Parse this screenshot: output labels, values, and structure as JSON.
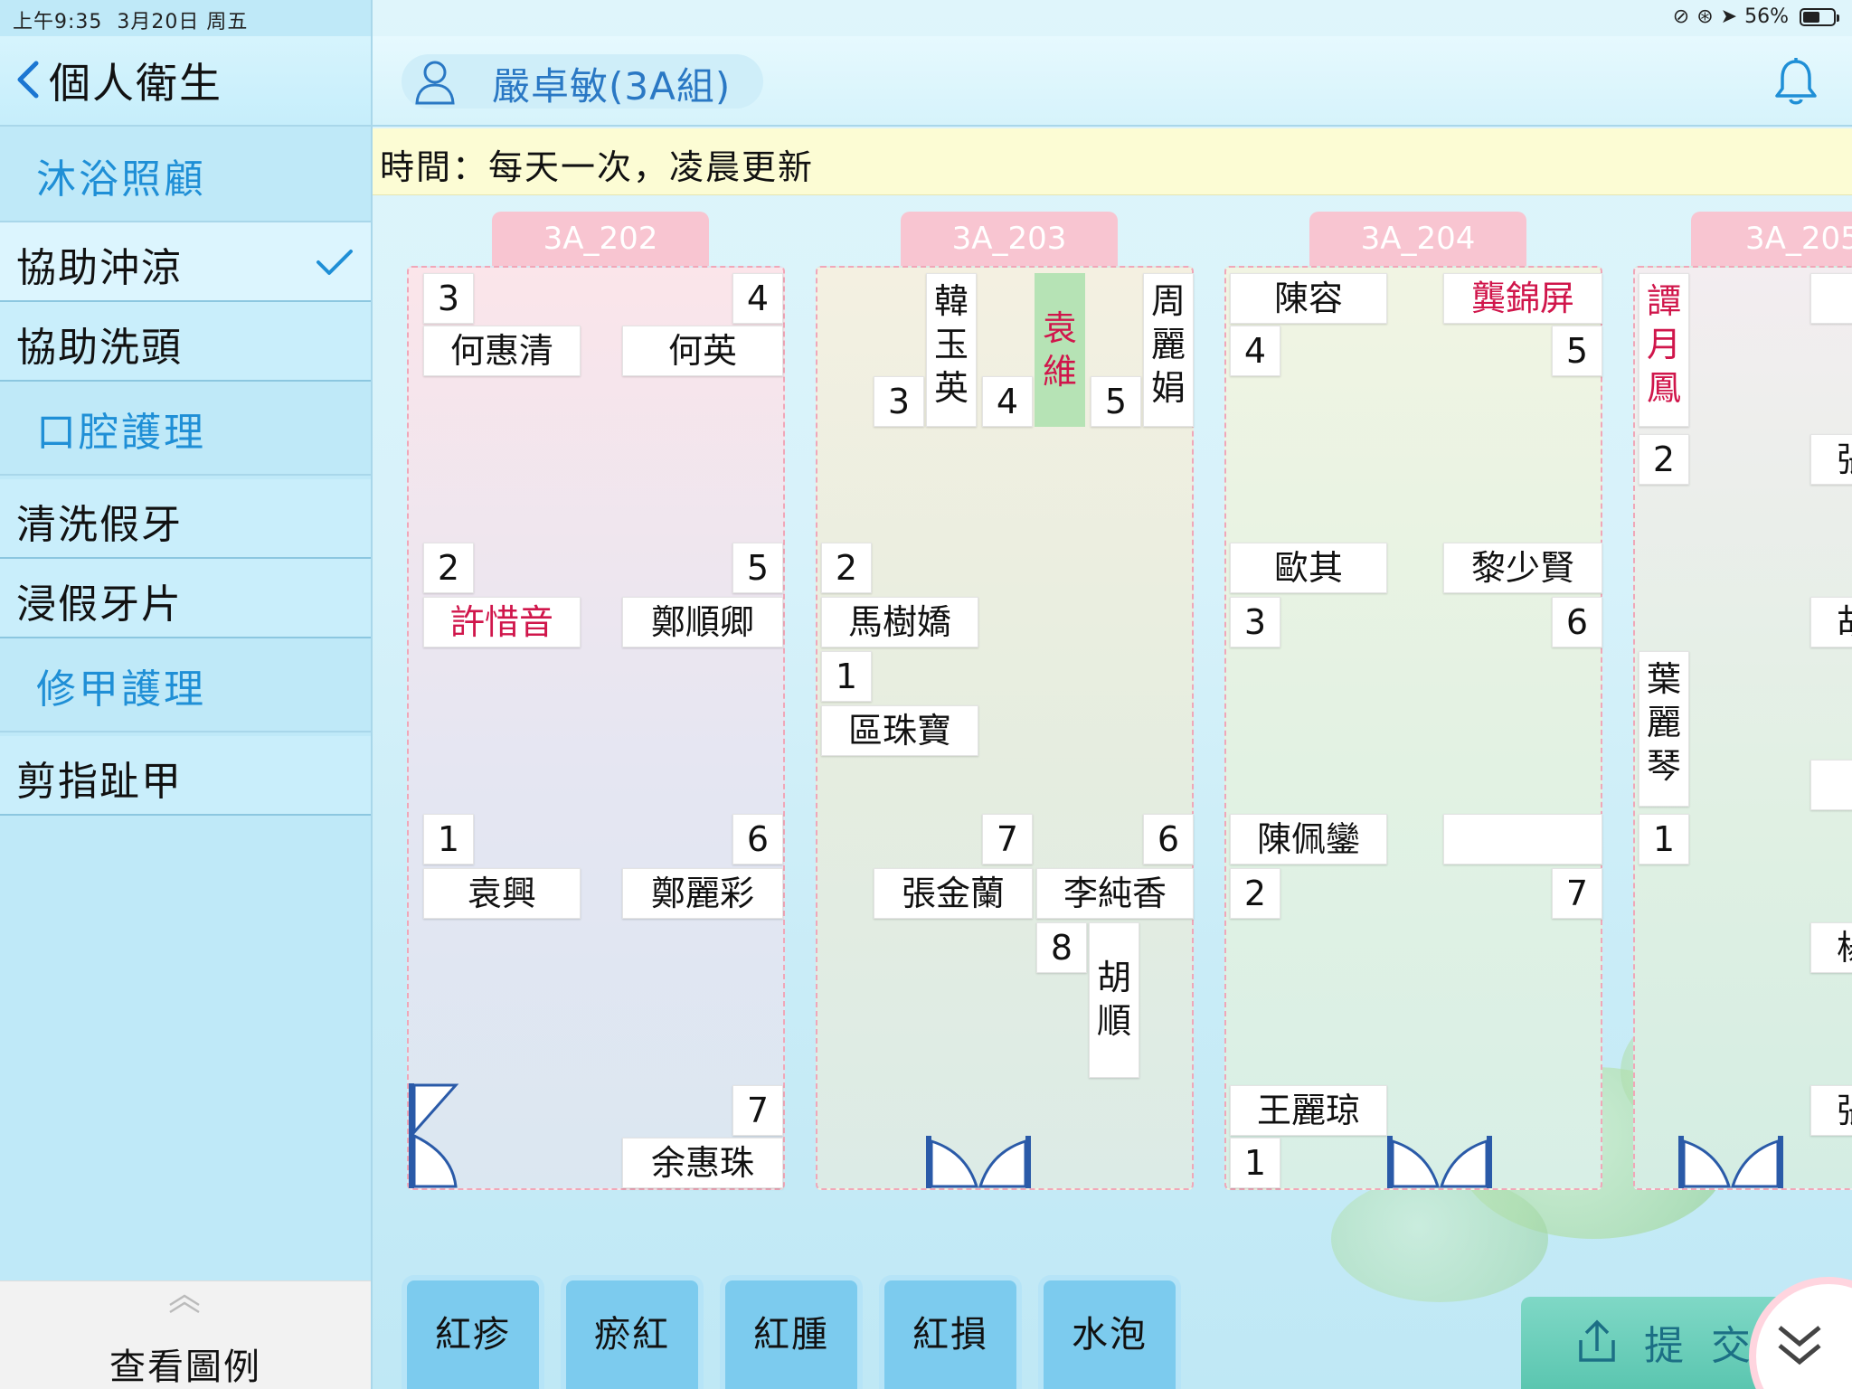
{
  "status_bar": {
    "time": "上午9:35",
    "date": "3月20日 周五",
    "battery": "56%",
    "battery_level": 0.56
  },
  "sidebar": {
    "title": "個人衛生",
    "sections": [
      {
        "label": "沐浴照顧",
        "items": [
          "協助沖涼",
          "協助洗頭"
        ]
      },
      {
        "label": "口腔護理",
        "items": [
          "清洗假牙",
          "浸假牙片"
        ]
      },
      {
        "label": "修甲護理",
        "items": [
          "剪指趾甲"
        ]
      }
    ],
    "selected_item": "協助沖涼",
    "legend_label": "查看圖例"
  },
  "header": {
    "user": "嚴卓敏(3A組)"
  },
  "info": {
    "text": "時間：每天一次，凌晨更新"
  },
  "rooms": [
    {
      "name": "3A_202",
      "beds": [
        {
          "num": "3",
          "name": "何惠清"
        },
        {
          "num": "4",
          "name": "何英"
        },
        {
          "num": "2",
          "name": "許惜音",
          "highlight": "red"
        },
        {
          "num": "5",
          "name": "鄭順卿"
        },
        {
          "num": "1",
          "name": "袁興"
        },
        {
          "num": "6",
          "name": "鄭麗彩"
        },
        {
          "num": "7",
          "name": "余惠珠"
        }
      ]
    },
    {
      "name": "3A_203",
      "beds": [
        {
          "num": "3",
          "name": "韓玉英"
        },
        {
          "num": "4",
          "name": "袁維",
          "highlight": "red",
          "status": "green"
        },
        {
          "num": "5",
          "name": "周麗娟"
        },
        {
          "num": "2",
          "name": "馬樹嬌"
        },
        {
          "num": "1",
          "name": "區珠寶"
        },
        {
          "num": "7",
          "name": "張金蘭"
        },
        {
          "num": "6",
          "name": "李純香"
        },
        {
          "num": "8",
          "name": "胡順"
        }
      ]
    },
    {
      "name": "3A_204",
      "beds": [
        {
          "num": "4",
          "name": "陳容"
        },
        {
          "num": "5",
          "name": "龔錦屏",
          "highlight": "red"
        },
        {
          "num": "3",
          "name": "歐其"
        },
        {
          "num": "6",
          "name": "黎少賢"
        },
        {
          "num": "2",
          "name": "陳佩鑾"
        },
        {
          "num": "7",
          "name": ""
        },
        {
          "num": "1",
          "name": "王麗琼"
        }
      ]
    },
    {
      "name": "3A_205",
      "beds": [
        {
          "num": "2",
          "name": "譚月鳳",
          "highlight": "red"
        },
        {
          "num": "1",
          "name": "葉麗琴"
        }
      ],
      "partial_names": [
        "張",
        "胡",
        "楊",
        "張"
      ]
    }
  ],
  "categories": [
    "紅疹",
    "瘀紅",
    "紅腫",
    "紅損",
    "水泡"
  ],
  "submit_label": "提交",
  "colors": {
    "accent": "#1f8fd6",
    "alert": "#d0164b",
    "tab": "#f8c5d1",
    "occupied": "#b6e3b5"
  }
}
